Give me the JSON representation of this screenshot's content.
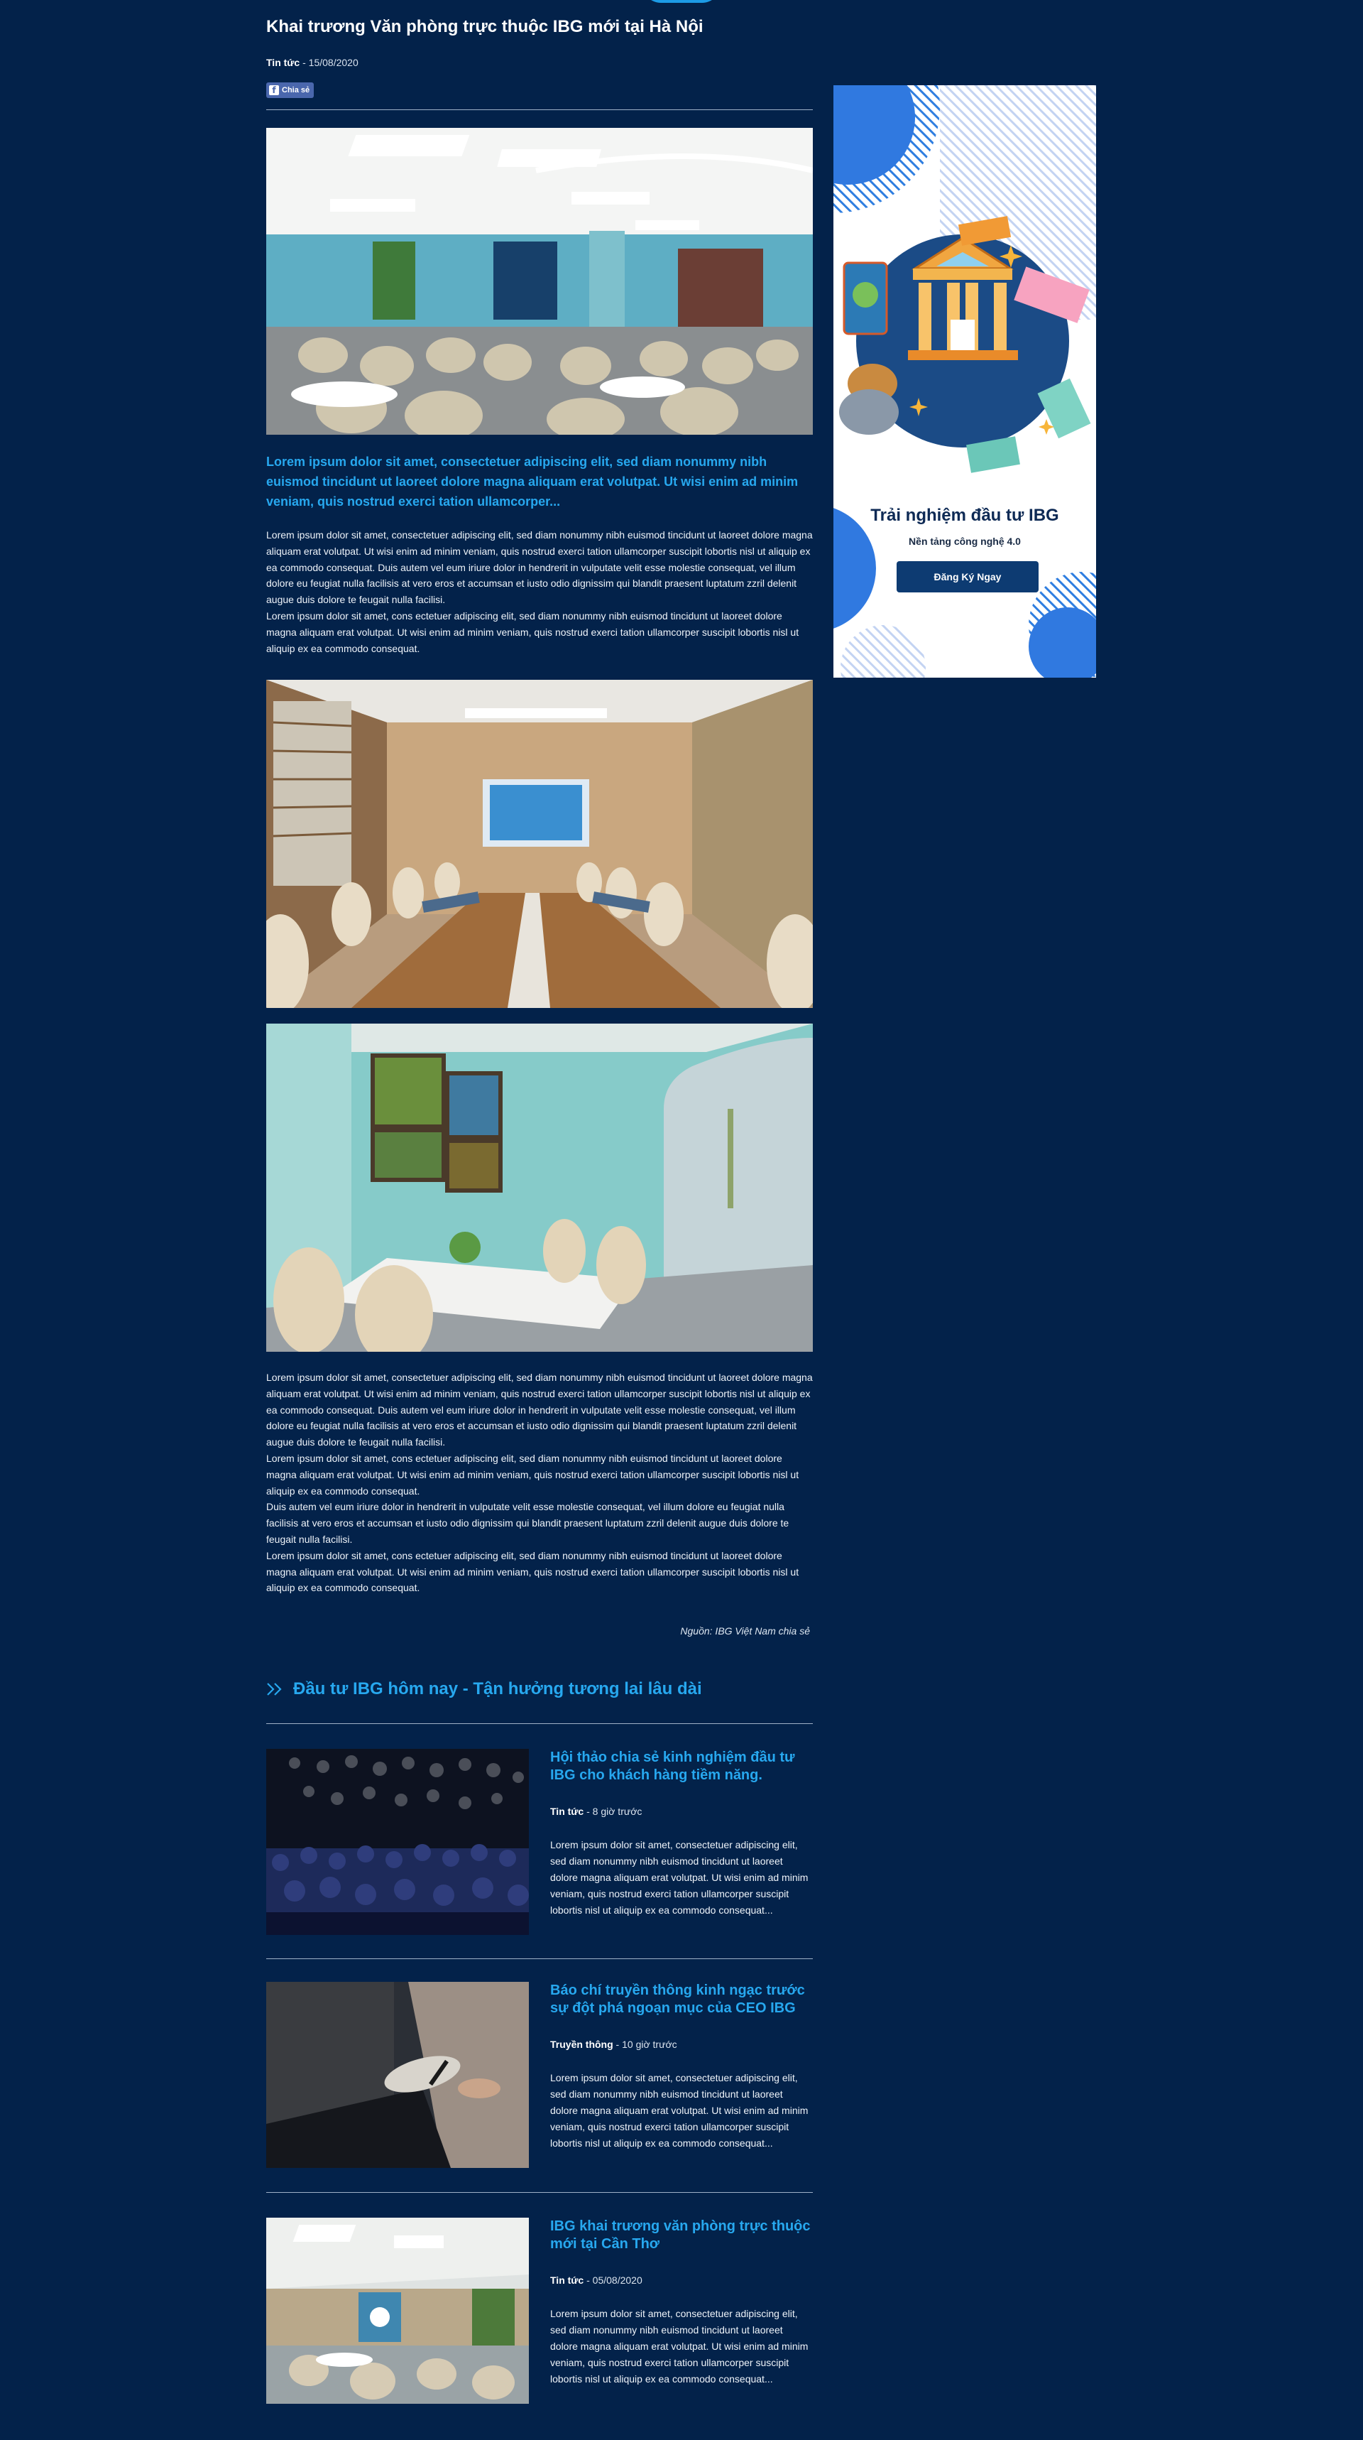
{
  "article": {
    "title": "Khai trương Văn phòng trực thuộc IBG mới tại Hà Nội",
    "category": "Tin tức",
    "meta_rest": " - 15/08/2020",
    "share_label": "Chia sẻ",
    "share_icon": "facebook-icon",
    "lead": "Lorem ipsum dolor sit amet, consectetuer adipiscing elit, sed diam nonummy nibh euismod tincidunt ut laoreet dolore magna aliquam erat volutpat. Ut wisi enim ad minim veniam, quis nostrud exerci tation ullamcorper...",
    "para1": "Lorem ipsum dolor sit amet, consectetuer adipiscing elit, sed diam nonummy nibh euismod tincidunt ut laoreet dolore magna aliquam erat volutpat. Ut wisi enim ad minim veniam, quis nostrud exerci tation ullamcorper suscipit lobortis nisl ut aliquip ex ea commodo consequat. Duis autem vel eum iriure dolor in hendrerit in vulputate velit esse molestie consequat, vel illum dolore eu feugiat nulla facilisis at vero eros et accumsan et iusto odio dignissim qui blandit praesent luptatum zzril delenit augue duis dolore te feugait nulla facilisi.\nLorem ipsum dolor sit amet, cons ectetuer adipiscing elit, sed diam nonummy nibh euismod tincidunt ut laoreet dolore magna aliquam erat volutpat. Ut wisi enim ad minim veniam, quis nostrud exerci tation ullamcorper suscipit lobortis nisl ut aliquip ex ea commodo consequat.",
    "para2": "Lorem ipsum dolor sit amet, consectetuer adipiscing elit, sed diam nonummy nibh euismod tincidunt ut laoreet dolore magna aliquam erat volutpat. Ut wisi enim ad minim veniam, quis nostrud exerci tation ullamcorper suscipit lobortis nisl ut aliquip ex ea commodo consequat. Duis autem vel eum iriure dolor in hendrerit in vulputate velit esse molestie consequat, vel illum dolore eu feugiat nulla facilisis at vero eros et accumsan et iusto odio dignissim qui blandit praesent luptatum zzril delenit augue duis dolore te feugait nulla facilisi.\nLorem ipsum dolor sit amet, cons ectetuer adipiscing elit, sed diam nonummy nibh euismod tincidunt ut laoreet dolore magna aliquam erat volutpat. Ut wisi enim ad minim veniam, quis nostrud exerci tation ullamcorper suscipit lobortis nisl ut aliquip ex ea commodo consequat.\nDuis autem vel eum iriure dolor in hendrerit in vulputate velit esse molestie consequat, vel illum dolore eu feugiat nulla facilisis at vero eros et accumsan et iusto odio dignissim qui blandit praesent luptatum zzril delenit augue duis dolore te feugait nulla facilisi.\nLorem ipsum dolor sit amet, cons ectetuer adipiscing elit, sed diam nonummy nibh euismod tincidunt ut laoreet dolore magna aliquam erat volutpat. Ut wisi enim ad minim veniam, quis nostrud exerci tation ullamcorper suscipit lobortis nisl ut aliquip ex ea commodo consequat.",
    "source": "Nguồn: IBG Việt Nam chia sẻ"
  },
  "related": {
    "icon": "double-chevron-right-icon",
    "heading": "Đầu tư IBG hôm nay - Tận hưởng tương lai lâu dài",
    "items": [
      {
        "title": "Hội thảo chia sẻ kinh nghiệm đầu tư IBG cho khách hàng tiềm năng.",
        "category": "Tin tức",
        "meta_rest": " - 8 giờ trước",
        "desc": "Lorem ipsum dolor sit amet, consectetuer adipiscing elit, sed diam nonummy nibh euismod tincidunt ut laoreet dolore magna aliquam erat volutpat. Ut wisi enim ad minim veniam, quis nostrud exerci tation ullamcorper suscipit lobortis nisl ut aliquip ex ea commodo consequat..."
      },
      {
        "title": "Báo chí truyền thông kinh ngạc trước sự đột phá ngoạn mục của CEO IBG",
        "category": "Truyền thông",
        "meta_rest": " - 10 giờ trước",
        "desc": "Lorem ipsum dolor sit amet, consectetuer adipiscing elit, sed diam nonummy nibh euismod tincidunt ut laoreet dolore magna aliquam erat volutpat. Ut wisi enim ad minim veniam, quis nostrud exerci tation ullamcorper suscipit lobortis nisl ut aliquip ex ea commodo consequat..."
      },
      {
        "title": "IBG khai trương văn phòng trực thuộc mới tại Cần Thơ",
        "category": "Tin tức",
        "meta_rest": " - 05/08/2020",
        "desc": "Lorem ipsum dolor sit amet, consectetuer adipiscing elit, sed diam nonummy nibh euismod tincidunt ut laoreet dolore magna aliquam erat volutpat. Ut wisi enim ad minim veniam, quis nostrud exerci tation ullamcorper suscipit lobortis nisl ut aliquip ex ea commodo consequat..."
      }
    ]
  },
  "sidebar": {
    "title": "Trải nghiệm đầu tư IBG",
    "subtitle": "Nền tảng công nghệ 4.0",
    "button": "Đăng Ký Ngay"
  },
  "colors": {
    "background": "#03224a",
    "accent": "#27a8ef",
    "button": "#0d3b72",
    "facebook": "#4a67ad"
  }
}
